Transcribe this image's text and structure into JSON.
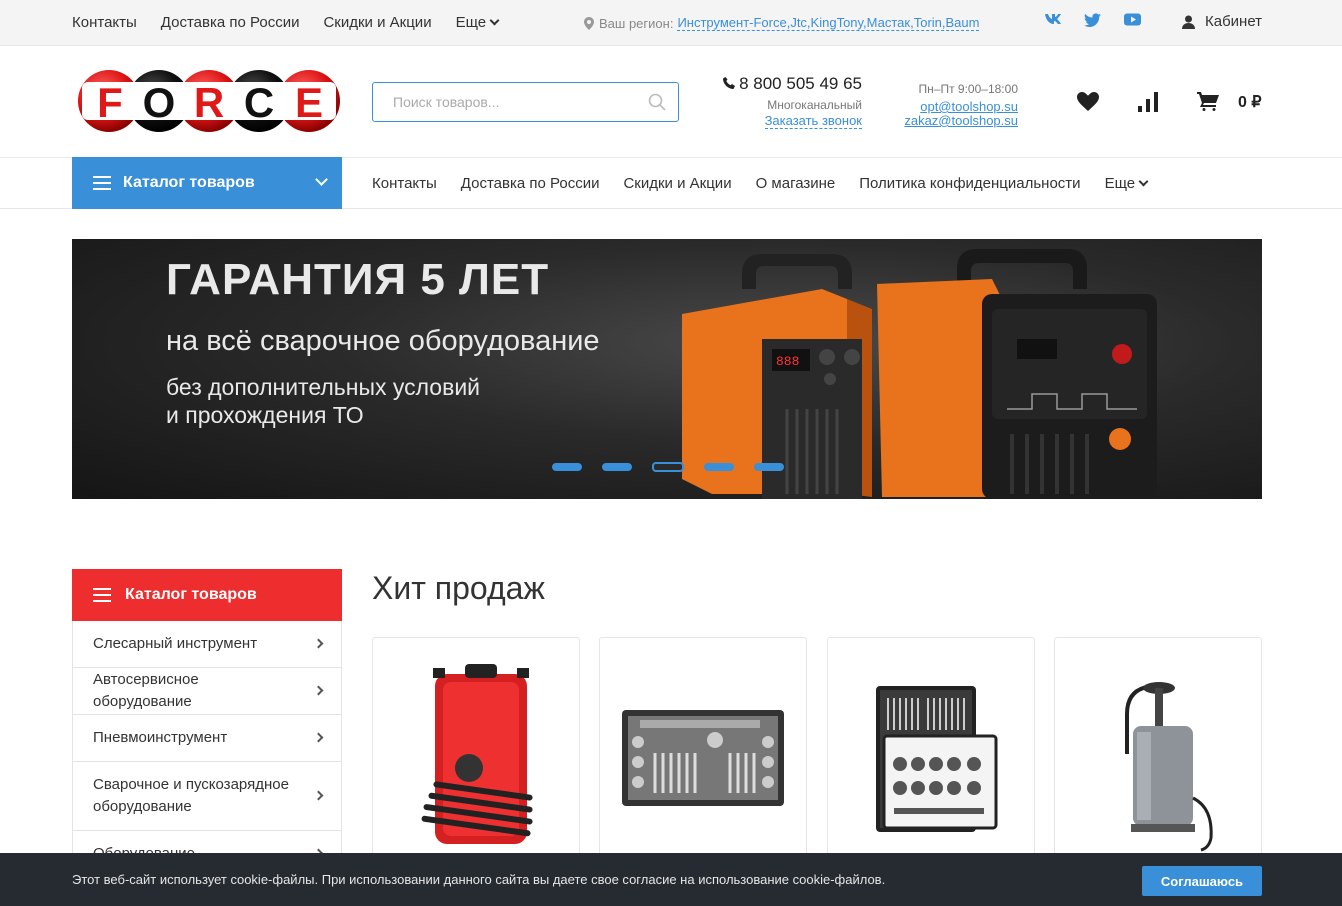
{
  "topbar": {
    "links": [
      "Контакты",
      "Доставка по России",
      "Скидки и Акции",
      "Еще"
    ],
    "region_label": "Ваш регион:",
    "region_value": "Инструмент-Force,Jtc,KingTony,Мастак,Torin,Baum",
    "social": [
      "vk-icon",
      "twitter-icon",
      "youtube-icon"
    ],
    "cabinet": "Кабинет"
  },
  "header": {
    "logo_text": "FORCE",
    "search_placeholder": "Поиск товаров...",
    "phone": "8 800 505 49 65",
    "phone_sub": "Многоканальный",
    "callback": "Заказать звонок",
    "hours": "Пн–Пт 9:00–18:00",
    "email1": "opt@toolshop.su",
    "email2": "zakaz@toolshop.su",
    "cart_sum": "0 ₽"
  },
  "nav": {
    "catalog_label": "Каталог товаров",
    "links": [
      "Контакты",
      "Доставка по России",
      "Скидки и Акции",
      "О магазине",
      "Политика конфиденциальности",
      "Еще"
    ]
  },
  "banner": {
    "title": "ГАРАНТИЯ 5 ЛЕТ",
    "subtitle": "на всё сварочное оборудование",
    "line1": "без дополнительных условий",
    "line2": "и прохождения ТО",
    "slides": 5,
    "active_slide": 3
  },
  "sidebar": {
    "title": "Каталог товаров",
    "items": [
      "Слесарный инструмент",
      "Автосервисное оборудование",
      "Пневмоинструмент",
      "Сварочное и пускозарядное оборудование",
      "Оборудование"
    ]
  },
  "hits": {
    "title": "Хит продаж"
  },
  "cookie": {
    "text": "Этот веб-сайт использует cookie-файлы. При использовании данного сайта вы даете свое согласие на использование cookie-файлов.",
    "button": "Соглашаюсь"
  },
  "colors": {
    "accent": "#3a8fd9",
    "catalog_red": "#ee2e2e",
    "cookie_bg": "#262a31"
  }
}
